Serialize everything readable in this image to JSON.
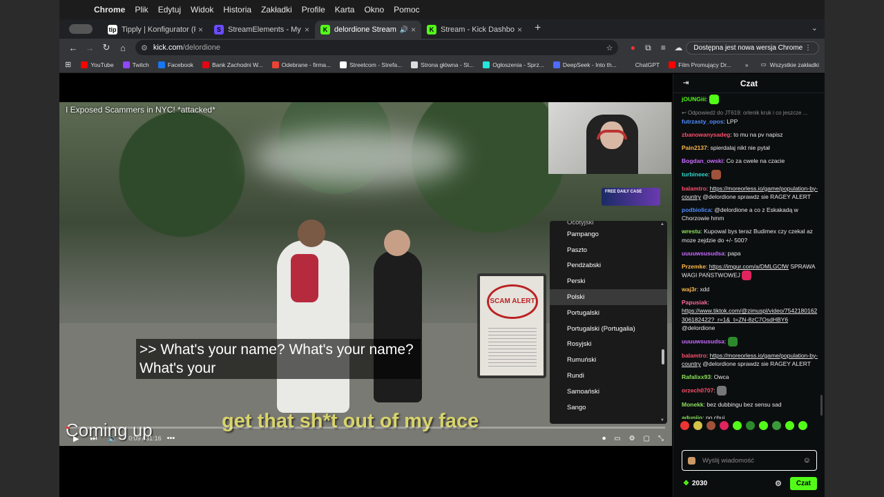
{
  "menubar": {
    "app": "Chrome",
    "items": [
      "Plik",
      "Edytuj",
      "Widok",
      "Historia",
      "Zakładki",
      "Profile",
      "Karta",
      "Okno",
      "Pomoc"
    ]
  },
  "tabs": [
    {
      "title": "Tipply | Konfigurator (Powiadomienia)",
      "fav_color": "#ffffff",
      "fav_text": "tip"
    },
    {
      "title": "StreamElements - My dashboard",
      "fav_color": "#6b4cff",
      "fav_text": "S"
    },
    {
      "title": "delordione Stream - Watch",
      "fav_color": "#53fc18",
      "fav_text": "K",
      "active": true
    },
    {
      "title": "Stream - Kick Dashboard",
      "fav_color": "#53fc18",
      "fav_text": "K"
    }
  ],
  "omnibox": {
    "domain": "kick.com",
    "path": "/delordione"
  },
  "update_label": "Dostępna jest nowa wersja Chrome",
  "bookmarks": [
    {
      "label": "YouTube",
      "color": "#ff0000"
    },
    {
      "label": "Twitch",
      "color": "#9146ff"
    },
    {
      "label": "Facebook",
      "color": "#1877f2"
    },
    {
      "label": "Bank Zachodni W...",
      "color": "#e30613"
    },
    {
      "label": "Odebrane - firma...",
      "color": "#ea4335"
    },
    {
      "label": "Streetcom - Strefa...",
      "color": "#ffffff"
    },
    {
      "label": "Strona główna - St...",
      "color": "#dddddd"
    },
    {
      "label": "Ogłoszenia - Sprz...",
      "color": "#23e5db"
    },
    {
      "label": "DeepSeek - Into th...",
      "color": "#4d6bfe"
    },
    {
      "label": "ChatGPT",
      "color": "#35363a"
    },
    {
      "label": "Film Promujący Dr...",
      "color": "#ff0000"
    }
  ],
  "bookmarks_all": "Wszystkie zakładki",
  "video": {
    "title": "I Exposed Scammers in NYC! *attacked*",
    "subtitle_line1": ">> What's your name? What's your name?",
    "subtitle_line2": "What's your",
    "hardsub": "get that sh*t out of my face",
    "coming_up": "Coming up",
    "time": "0:09 / 31:16",
    "progress": 0.005,
    "sign_text": "SCAM ALERT",
    "banner_text": "FREE DAILY CASE"
  },
  "language_menu": {
    "items": [
      "Pampango",
      "Paszto",
      "Pendżabski",
      "Perski",
      "Polski",
      "Portugalski",
      "Portugalski (Portugalia)",
      "Rosyjski",
      "Rumuński",
      "Rundi",
      "Samoański",
      "Sango"
    ],
    "selected": "Polski",
    "cut_top": "Ocotyjski"
  },
  "chat": {
    "title": "Czat",
    "messages": [
      {
        "user": "jOUNGiii",
        "color": "#53fc18",
        "text": "",
        "emote": "#53fc18"
      },
      {
        "reply": "Odpowiedź do JT619: orlenik kruk i co jeszcze ...",
        "user": "futrzasty_opos",
        "color": "#4f8cff",
        "text": "LPP"
      },
      {
        "user": "zbanowanysadeg",
        "color": "#ff4f6d",
        "text": "to mu na pv napisz"
      },
      {
        "user": "Pain2137",
        "color": "#ffb84d",
        "text": "spierdalaj nikt nie pytał"
      },
      {
        "user": "Bogdan_owski",
        "color": "#c86bff",
        "text": "Co za cwele na czacie"
      },
      {
        "user": "turbineee",
        "color": "#33d6c8",
        "text": "",
        "emote": "#a0523a"
      },
      {
        "user": "balamtro",
        "color": "#ff4f6d",
        "link": "https://moreorless.io/game/population-by-country",
        "text": "@delordione sprawdz sie RAGEY ALERT"
      },
      {
        "user": "podbiolica",
        "color": "#4f8cff",
        "text": "@delordione a co z Eskakadą w Chorzowie hmm"
      },
      {
        "user": "wrestu",
        "color": "#8ce35a",
        "text": "Kupowal bys teraz Budimex czy czekal az moze zejdzie do +/- 500?"
      },
      {
        "user": "uuuuwsusudsa",
        "color": "#c86bff",
        "text": "papa"
      },
      {
        "user": "Przemke",
        "color": "#ffb84d",
        "link": "https://imgur.com/a/DMLGCfW",
        "text": "SPRAWA WAGI PAŃSTWOWEJ",
        "emote": "#e0245e"
      },
      {
        "user": "waj3r",
        "color": "#ffb84d",
        "text": "xdd"
      },
      {
        "user": "Papusiak",
        "color": "#ff6b9a",
        "link": "https://www.tiktok.com/@zimuspl/video/7542180162306182422?_r=1&_t=ZN-8zC7OsdHBY6",
        "text": "@delordione"
      },
      {
        "user": "uuuuwsusudsa",
        "color": "#c86bff",
        "text": "",
        "emote": "#2c8a2c"
      },
      {
        "user": "balamtro",
        "color": "#ff4f6d",
        "link": "https://moreorless.io/game/population-by-country",
        "text": "@delordione sprawdz sie RAGEY ALERT"
      },
      {
        "user": "Rafalixx93",
        "color": "#8ce35a",
        "text": "Owca"
      },
      {
        "user": "orzech0707",
        "color": "#ff4f6d",
        "text": "",
        "emote": "#777777"
      },
      {
        "user": "Monekk",
        "color": "#8ce35a",
        "text": "bez dubbingu bez sensu sad"
      },
      {
        "user": "aduniio",
        "color": "#8ce35a",
        "text": "po chuj"
      }
    ],
    "input_placeholder": "Wyślij wiadomość",
    "points": "2030",
    "send_label": "Czat"
  }
}
